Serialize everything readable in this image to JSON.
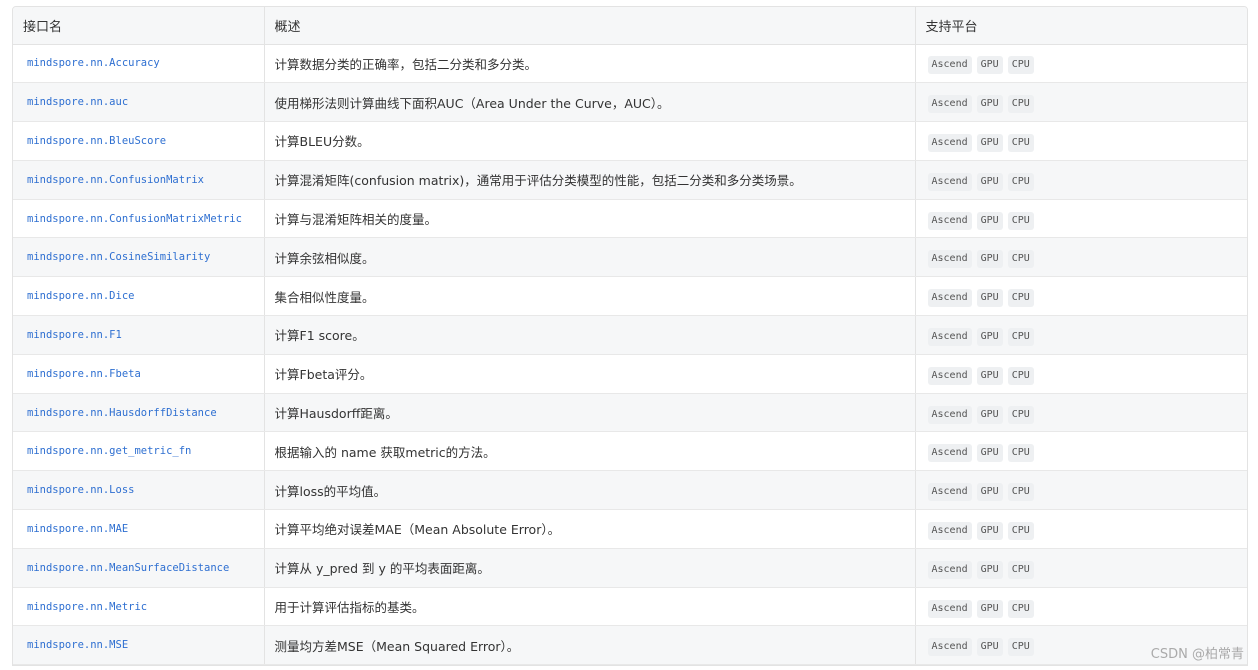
{
  "table": {
    "headers": [
      "接口名",
      "概述",
      "支持平台"
    ],
    "rows": [
      {
        "api": "mindspore.nn.Accuracy",
        "desc": "计算数据分类的正确率，包括二分类和多分类。",
        "platforms": [
          "Ascend",
          "GPU",
          "CPU"
        ]
      },
      {
        "api": "mindspore.nn.auc",
        "desc": "使用梯形法则计算曲线下面积AUC（Area Under the Curve，AUC）。",
        "platforms": [
          "Ascend",
          "GPU",
          "CPU"
        ]
      },
      {
        "api": "mindspore.nn.BleuScore",
        "desc": "计算BLEU分数。",
        "platforms": [
          "Ascend",
          "GPU",
          "CPU"
        ]
      },
      {
        "api": "mindspore.nn.ConfusionMatrix",
        "desc": "计算混淆矩阵(confusion matrix)，通常用于评估分类模型的性能，包括二分类和多分类场景。",
        "platforms": [
          "Ascend",
          "GPU",
          "CPU"
        ]
      },
      {
        "api": "mindspore.nn.ConfusionMatrixMetric",
        "desc": "计算与混淆矩阵相关的度量。",
        "platforms": [
          "Ascend",
          "GPU",
          "CPU"
        ]
      },
      {
        "api": "mindspore.nn.CosineSimilarity",
        "desc": "计算余弦相似度。",
        "platforms": [
          "Ascend",
          "GPU",
          "CPU"
        ]
      },
      {
        "api": "mindspore.nn.Dice",
        "desc": "集合相似性度量。",
        "platforms": [
          "Ascend",
          "GPU",
          "CPU"
        ]
      },
      {
        "api": "mindspore.nn.F1",
        "desc": "计算F1 score。",
        "platforms": [
          "Ascend",
          "GPU",
          "CPU"
        ]
      },
      {
        "api": "mindspore.nn.Fbeta",
        "desc": "计算Fbeta评分。",
        "platforms": [
          "Ascend",
          "GPU",
          "CPU"
        ]
      },
      {
        "api": "mindspore.nn.HausdorffDistance",
        "desc": "计算Hausdorff距离。",
        "platforms": [
          "Ascend",
          "GPU",
          "CPU"
        ]
      },
      {
        "api": "mindspore.nn.get_metric_fn",
        "desc": "根据输入的 name 获取metric的方法。",
        "platforms": [
          "Ascend",
          "GPU",
          "CPU"
        ]
      },
      {
        "api": "mindspore.nn.Loss",
        "desc": "计算loss的平均值。",
        "platforms": [
          "Ascend",
          "GPU",
          "CPU"
        ]
      },
      {
        "api": "mindspore.nn.MAE",
        "desc": "计算平均绝对误差MAE（Mean Absolute Error）。",
        "platforms": [
          "Ascend",
          "GPU",
          "CPU"
        ]
      },
      {
        "api": "mindspore.nn.MeanSurfaceDistance",
        "desc": "计算从 y_pred 到 y 的平均表面距离。",
        "platforms": [
          "Ascend",
          "GPU",
          "CPU"
        ]
      },
      {
        "api": "mindspore.nn.Metric",
        "desc": "用于计算评估指标的基类。",
        "platforms": [
          "Ascend",
          "GPU",
          "CPU"
        ]
      },
      {
        "api": "mindspore.nn.MSE",
        "desc": "测量均方差MSE（Mean Squared Error）。",
        "platforms": [
          "Ascend",
          "GPU",
          "CPU"
        ]
      }
    ]
  },
  "watermark": "CSDN @柏常青",
  "colors": {
    "link": "#2e6fd1",
    "header_bg": "#f6f7f8",
    "tag_bg": "#eef0f2"
  }
}
